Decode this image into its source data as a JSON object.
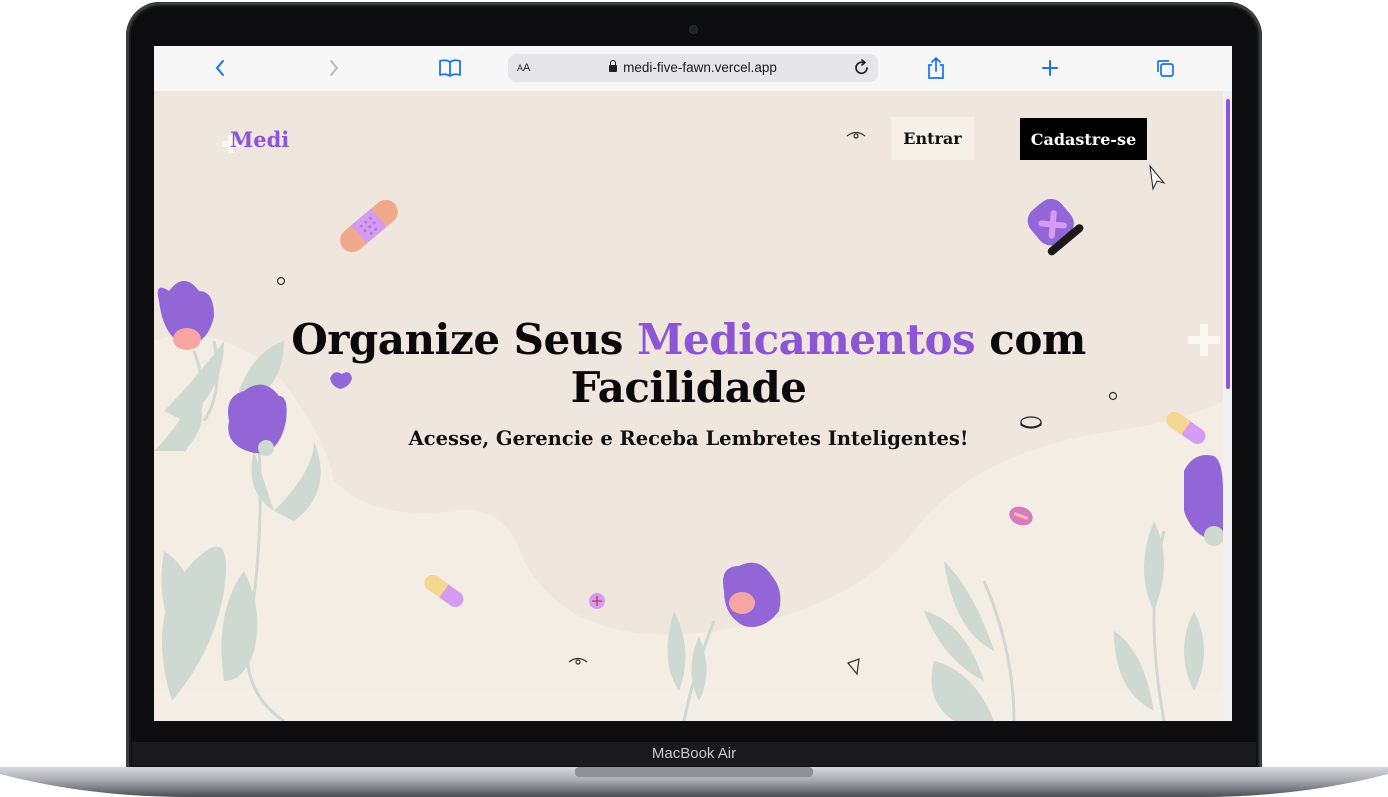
{
  "device": {
    "label": "MacBook Air"
  },
  "browser": {
    "text_size_label": "AA",
    "url": "medi-five-fawn.vercel.app"
  },
  "header": {
    "logo": "Medi",
    "login_label": "Entrar",
    "signup_label": "Cadastre-se"
  },
  "hero": {
    "title_part1": "Organize Seus ",
    "title_accent": "Medicamentos",
    "title_part2": " com",
    "title_line2": "Facilidade",
    "subtitle": "Acesse, Gerencie e Receba Lembretes Inteligentes!"
  },
  "colors": {
    "accent": "#8b55d6",
    "background": "#efe7dd",
    "leaf": "#cdd9d1",
    "bandage": "#f0a98b",
    "button_dark": "#000000"
  }
}
